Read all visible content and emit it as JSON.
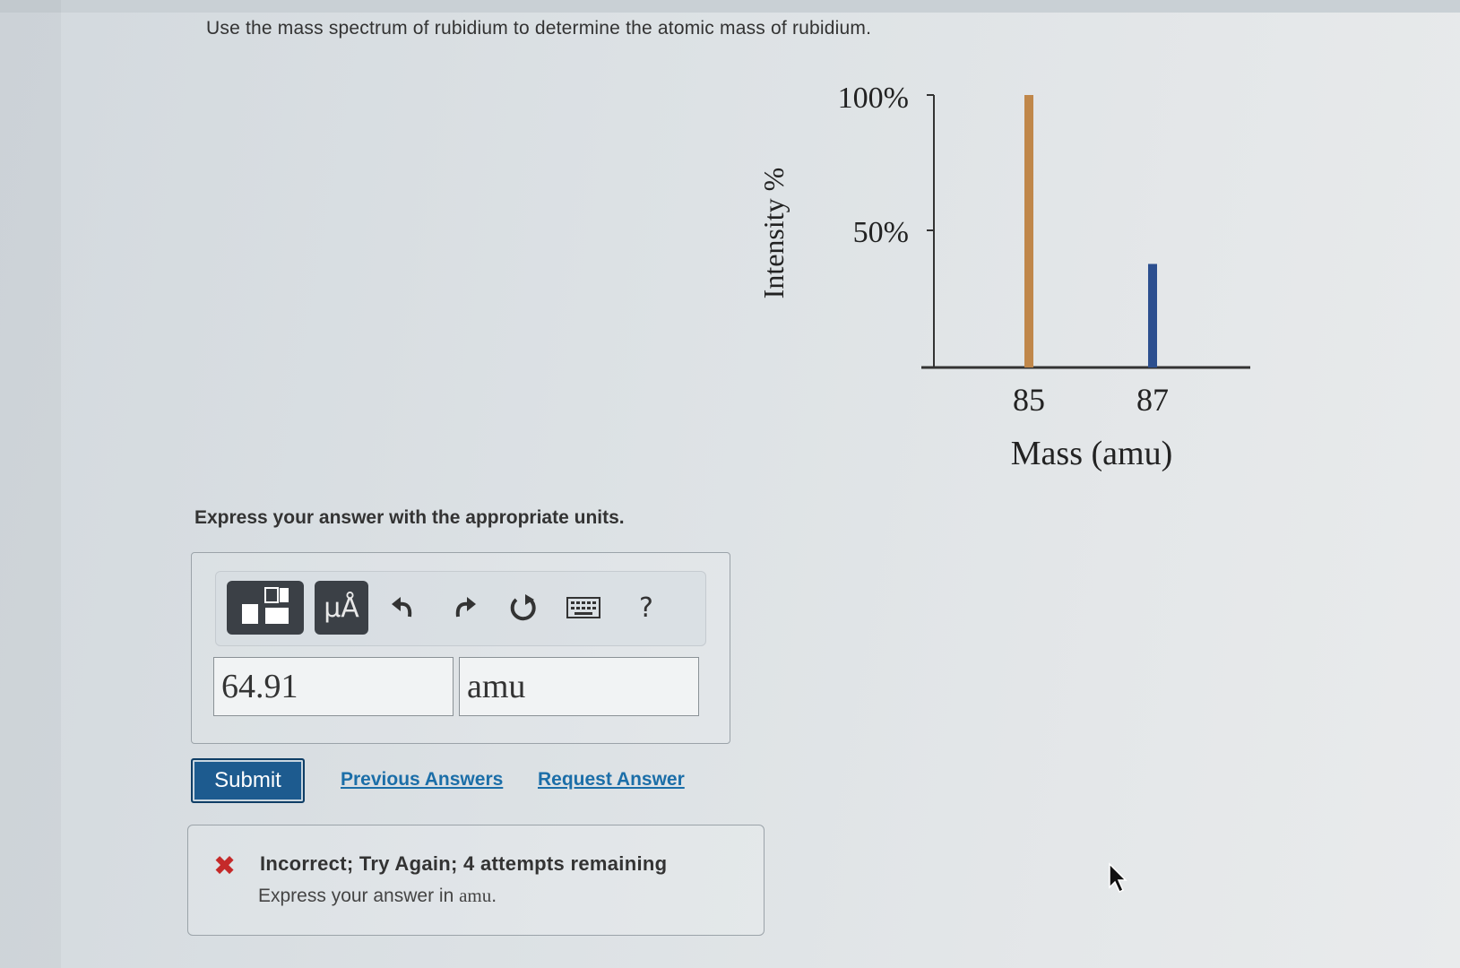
{
  "question": "Use the mass spectrum of rubidium to determine the atomic mass of rubidium.",
  "chart_data": {
    "type": "bar",
    "categories": [
      "85",
      "87"
    ],
    "values": [
      100,
      38
    ],
    "colors": [
      "#c0874a",
      "#2c4f8f"
    ],
    "ylabel": "Intensity %",
    "xlabel": "Mass (amu)",
    "yticks": [
      "100%",
      "50%"
    ],
    "ylim": [
      0,
      100
    ]
  },
  "instructions": "Express your answer with the appropriate units.",
  "toolbar": {
    "templates_icon": "templates-icon",
    "units_label": "µÅ",
    "undo_icon": "undo-icon",
    "redo_icon": "redo-icon",
    "reset_icon": "reset-icon",
    "keyboard_icon": "keyboard-icon",
    "help_label": "?"
  },
  "answer": {
    "value": "64.91",
    "units": "amu"
  },
  "actions": {
    "submit_label": "Submit",
    "previous_answers_label": "Previous Answers",
    "request_answer_label": "Request Answer"
  },
  "feedback": {
    "icon": "incorrect-x-icon",
    "title": "Incorrect; Try Again; 4 attempts remaining",
    "detail_prefix": "Express your answer in ",
    "detail_unit": "amu",
    "detail_suffix": "."
  }
}
